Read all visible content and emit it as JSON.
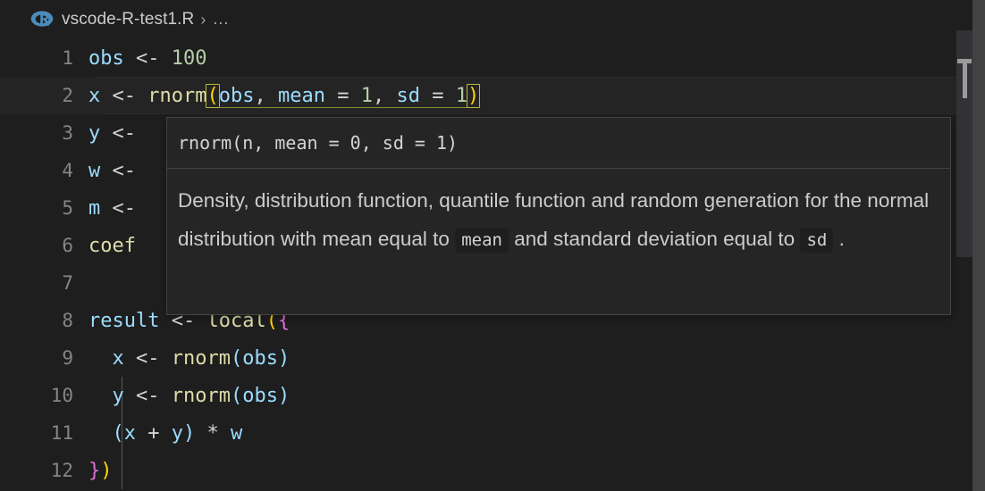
{
  "app": {
    "theme_bg": "#1e1e1e",
    "accent": "#9cdcfe"
  },
  "breadcrumb": {
    "file_icon": "r-language-icon",
    "file_name": "vscode-R-test1.R",
    "separator": "›",
    "overflow": "…"
  },
  "editor": {
    "lines": [
      {
        "number": "1",
        "text": "obs <- 100"
      },
      {
        "number": "2",
        "text": "x <- rnorm(obs, mean = 1, sd = 1)"
      },
      {
        "number": "3",
        "text": "y <-"
      },
      {
        "number": "4",
        "text": "w <-"
      },
      {
        "number": "5",
        "text": "m <-"
      },
      {
        "number": "6",
        "text": "coef"
      },
      {
        "number": "7",
        "text": ""
      },
      {
        "number": "8",
        "text": "result <- local({"
      },
      {
        "number": "9",
        "text": "  x <- rnorm(obs)"
      },
      {
        "number": "10",
        "text": "  y <- rnorm(obs)"
      },
      {
        "number": "11",
        "text": "  (x + y) * w"
      },
      {
        "number": "12",
        "text": "})"
      }
    ],
    "tokens": {
      "l1_var": "obs",
      "l1_op": "<-",
      "l1_num": "100",
      "l2_var": "x",
      "l2_op": "<-",
      "l2_fn": "rnorm",
      "l2_open": "(",
      "l2_args": "obs, mean = 1, sd = 1",
      "l2_close": ")",
      "l2_arg_obs": "obs",
      "l2_comma1": ", ",
      "l2_mean": "mean",
      "l2_eq1": " = ",
      "l2_one1": "1",
      "l2_comma2": ", ",
      "l2_sd": "sd",
      "l2_eq2": " = ",
      "l2_one2": "1",
      "l3_var": "y",
      "l3_op": "<-",
      "l4_var": "w",
      "l4_op": "<-",
      "l5_var": "m",
      "l5_op": "<-",
      "l6_fn": "coef",
      "l8_var": "result",
      "l8_op": "<-",
      "l8_fn": "local",
      "l8_paren": "(",
      "l8_brace": "{",
      "l9_var": "x",
      "l9_op": "<-",
      "l9_fn": "rnorm",
      "l9_open": "(",
      "l9_arg": "obs",
      "l9_close": ")",
      "l10_var": "y",
      "l10_op": "<-",
      "l10_fn": "rnorm",
      "l10_open": "(",
      "l10_arg": "obs",
      "l10_close": ")",
      "l11_open": "(",
      "l11_x": "x",
      "l11_plus": " + ",
      "l11_y": "y",
      "l11_close": ")",
      "l11_star": " * ",
      "l11_w": "w",
      "l12_brace": "}",
      "l12_paren": ")"
    }
  },
  "hover": {
    "signature": "rnorm(n, mean = 0, sd = 1)",
    "description_part1": "Density, distribution function, quantile function and random generation for the normal distribution with mean equal to ",
    "code_mean": "mean",
    "description_part2": " and standard deviation equal to ",
    "code_sd": "sd",
    "description_part3": " ."
  },
  "minimap": {
    "glyph": "T"
  }
}
